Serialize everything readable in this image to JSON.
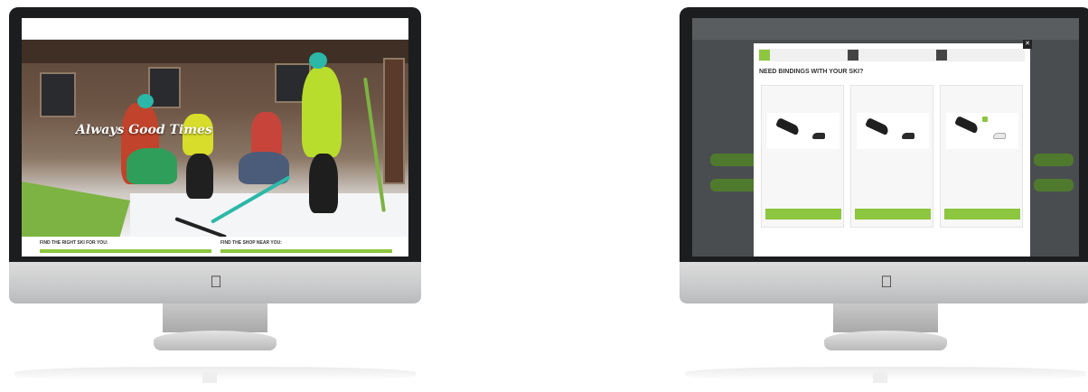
{
  "colors": {
    "accent_green": "#8dc63f",
    "bezel": "#1c1d1f",
    "aluminum": "#c9cacb",
    "overlay": "#4a4d4f"
  },
  "left_site": {
    "logo": "",
    "logo_sub": "",
    "nav_items": [
      "",
      "",
      "",
      "",
      "",
      "",
      "",
      ""
    ],
    "tagline": "Always Good Times",
    "sections": [
      {
        "title": "FIND THE RIGHT SKI FOR YOU:"
      },
      {
        "title": "FIND THE SHOP NEAR YOU:"
      }
    ]
  },
  "right_site": {
    "logo": "",
    "modal": {
      "steps": [
        {
          "number": "",
          "label": ""
        },
        {
          "number": "",
          "label": ""
        },
        {
          "number": "",
          "label": ""
        }
      ],
      "title": "NEED BINDINGS WITH YOUR SKI?",
      "subtitle": "",
      "cards": [
        {
          "name": "",
          "meta1": "",
          "meta2": "",
          "description": "",
          "price": "",
          "price_note": "",
          "button": ""
        },
        {
          "name": "",
          "meta1": "",
          "meta2": "",
          "description": "",
          "price": "",
          "price_note": "",
          "button": ""
        },
        {
          "name": "",
          "meta1": "",
          "meta2": "",
          "description": "",
          "price": "",
          "price_note": "",
          "button": ""
        }
      ],
      "footer": "",
      "close_icon": "close-icon"
    }
  },
  "apple_logo": ""
}
